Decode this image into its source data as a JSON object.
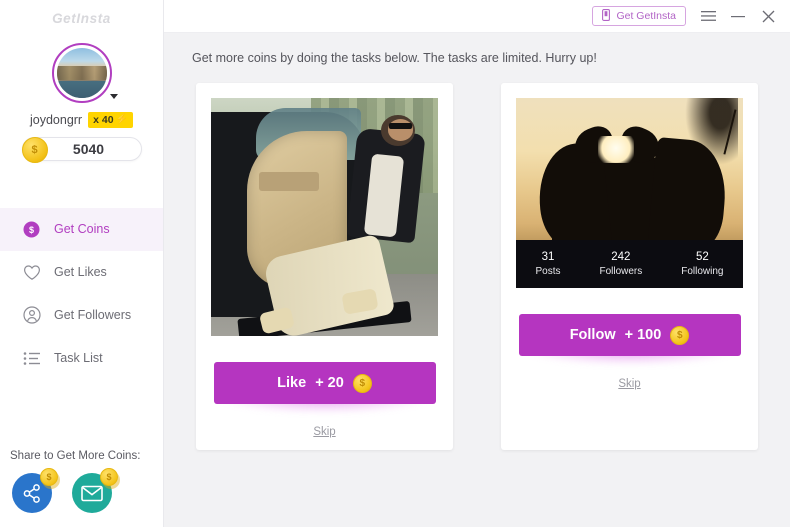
{
  "app": {
    "logo": "GetInsta"
  },
  "titlebar": {
    "get_app_label": "Get GetInsta",
    "phone_icon": "phone-icon",
    "menu_icon": "hamburger-menu-icon",
    "minimize_icon": "minimize-icon",
    "close_icon": "close-icon"
  },
  "sidebar": {
    "avatar": "user-avatar",
    "username": "joydongrr",
    "multiplier": "x 40",
    "bolt": "⚡",
    "coin_symbol": "$",
    "coin_balance": "5040",
    "items": [
      {
        "label": "Get Coins",
        "icon": "coin-icon",
        "active": true
      },
      {
        "label": "Get Likes",
        "icon": "heart-icon",
        "active": false
      },
      {
        "label": "Get Followers",
        "icon": "user-circle-icon",
        "active": false
      },
      {
        "label": "Task List",
        "icon": "list-icon",
        "active": false
      }
    ],
    "share_title": "Share to Get More Coins:",
    "share_items": [
      {
        "name": "share-network-button",
        "badge": "$"
      },
      {
        "name": "share-email-button",
        "badge": "$"
      }
    ]
  },
  "main": {
    "heading": "Get more coins by doing the tasks below. The tasks are limited. Hurry up!",
    "cards": [
      {
        "photo": "man-sitting-in-car-photo",
        "action_label": "Like",
        "reward": "+ 20",
        "coin_symbol": "$",
        "skip_label": "Skip",
        "stats": null
      },
      {
        "photo": "sunset-heart-hands-photo",
        "action_label": "Follow",
        "reward": "+ 100",
        "coin_symbol": "$",
        "skip_label": "Skip",
        "stats": [
          {
            "value": "31",
            "label": "Posts"
          },
          {
            "value": "242",
            "label": "Followers"
          },
          {
            "value": "52",
            "label": "Following"
          }
        ]
      }
    ]
  },
  "colors": {
    "accent": "#b13ec0",
    "button": "#b535c0",
    "coin": "#f3c318",
    "sidebar_bg": "#ffffff",
    "page_bg": "#f2f2f4"
  }
}
